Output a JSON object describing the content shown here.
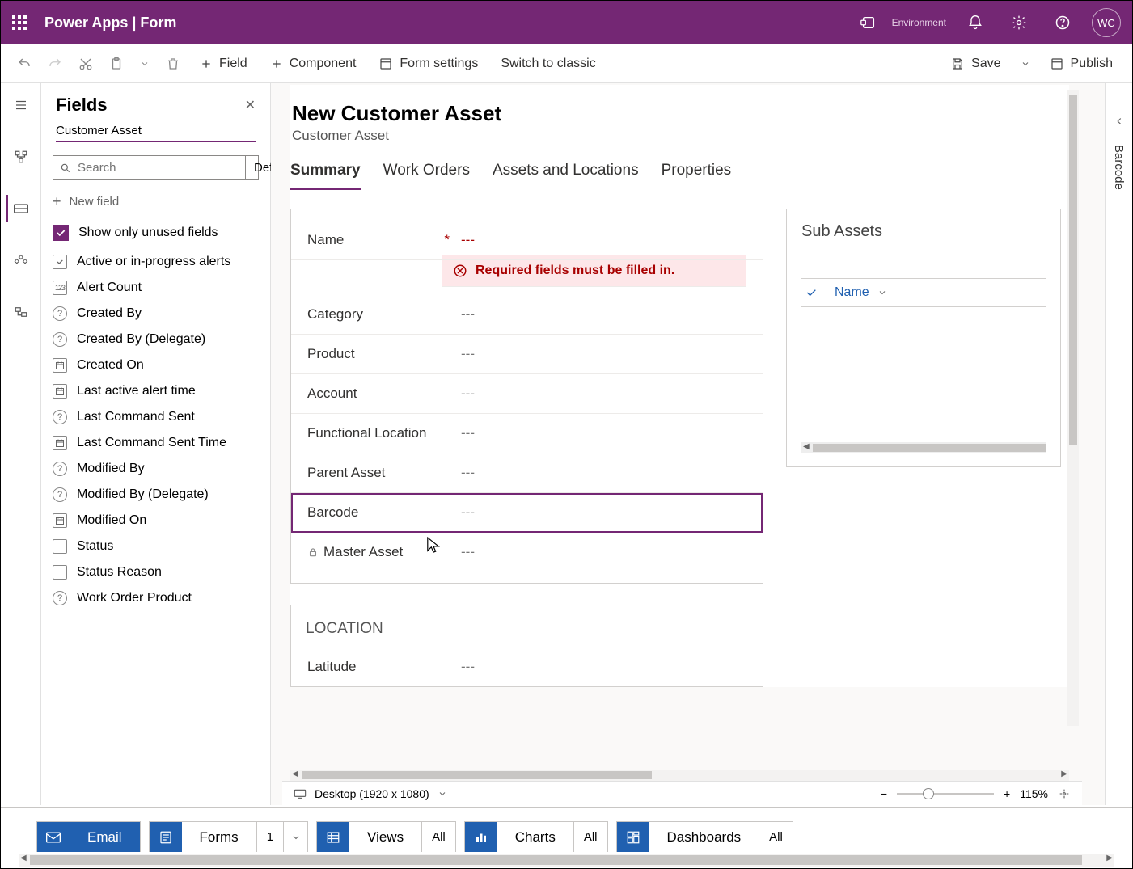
{
  "topbar": {
    "title": "Power Apps  |  Form",
    "env_label": "Environment",
    "avatar": "WC"
  },
  "cmd": {
    "field": "Field",
    "component": "Component",
    "form_settings": "Form settings",
    "switch": "Switch to classic",
    "save": "Save",
    "publish": "Publish"
  },
  "fields_panel": {
    "title": "Fields",
    "entity": "Customer Asset",
    "search_placeholder": "Search",
    "search_filter": "Default",
    "new_field": "New field",
    "show_unused": "Show only unused fields",
    "items": [
      {
        "icon": "check",
        "label": "Active or in-progress alerts"
      },
      {
        "icon": "num",
        "label": "Alert Count"
      },
      {
        "icon": "q",
        "label": "Created By"
      },
      {
        "icon": "q",
        "label": "Created By (Delegate)"
      },
      {
        "icon": "cal",
        "label": "Created On"
      },
      {
        "icon": "cal",
        "label": "Last active alert time"
      },
      {
        "icon": "q",
        "label": "Last Command Sent"
      },
      {
        "icon": "cal",
        "label": "Last Command Sent Time"
      },
      {
        "icon": "q",
        "label": "Modified By"
      },
      {
        "icon": "q",
        "label": "Modified By (Delegate)"
      },
      {
        "icon": "cal",
        "label": "Modified On"
      },
      {
        "icon": "box",
        "label": "Status"
      },
      {
        "icon": "box",
        "label": "Status Reason"
      },
      {
        "icon": "q",
        "label": "Work Order Product"
      }
    ]
  },
  "form": {
    "title": "New Customer Asset",
    "subtitle": "Customer Asset",
    "tabs": [
      {
        "label": "Summary",
        "active": true
      },
      {
        "label": "Work Orders"
      },
      {
        "label": "Assets and Locations"
      },
      {
        "label": "Properties"
      }
    ],
    "rows": [
      {
        "label": "Name",
        "value": "---",
        "required": true,
        "error": "Required fields must be filled in."
      },
      {
        "label": "Category",
        "value": "---"
      },
      {
        "label": "Product",
        "value": "---"
      },
      {
        "label": "Account",
        "value": "---"
      },
      {
        "label": "Functional Location",
        "value": "---"
      },
      {
        "label": "Parent Asset",
        "value": "---"
      },
      {
        "label": "Barcode",
        "value": "---",
        "selected": true
      },
      {
        "label": "Master Asset",
        "value": "---",
        "locked": true
      }
    ],
    "subassets": {
      "title": "Sub Assets",
      "col": "Name"
    },
    "location": {
      "title": "LOCATION",
      "rows": [
        {
          "label": "Latitude",
          "value": "---"
        }
      ]
    }
  },
  "statusbar": {
    "device": "Desktop (1920 x 1080)",
    "zoom": "115%"
  },
  "rightpane": {
    "label": "Barcode"
  },
  "bottom": {
    "tabs": [
      {
        "label": "Email",
        "kind": "email"
      },
      {
        "label": "Forms",
        "extra": "1",
        "dd": true
      },
      {
        "label": "Views",
        "extra": "All"
      },
      {
        "label": "Charts",
        "extra": "All"
      },
      {
        "label": "Dashboards",
        "extra": "All"
      }
    ]
  }
}
